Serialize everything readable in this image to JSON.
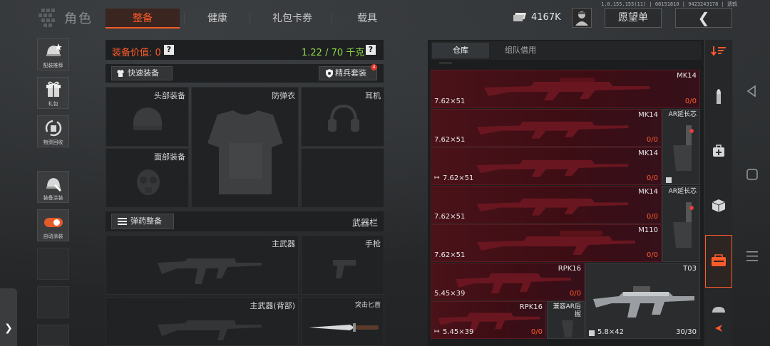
{
  "header": {
    "brand": "角色",
    "tabs": [
      {
        "label": "整备",
        "active": true
      },
      {
        "label": "健康",
        "active": false
      },
      {
        "label": "礼包卡券",
        "active": false
      },
      {
        "label": "载具",
        "active": false
      }
    ],
    "version": "1.0.155.155(11) | 08151810 | 9423243178 | 遗鹤",
    "currency": "4167K",
    "wishlist_label": "愿望单",
    "back_icon": "chevron-left-icon"
  },
  "sidebar": {
    "items": [
      {
        "label": "配装推荐",
        "icon": "helmet-star-icon"
      },
      {
        "label": "礼包",
        "icon": "gift-icon"
      },
      {
        "label": "物资回收",
        "icon": "recycle-icon"
      },
      {
        "label": "装备涂装",
        "icon": "paint-helmet-icon"
      },
      {
        "label": "自动涂装",
        "icon": "toggle-icon",
        "toggle_on": true
      }
    ]
  },
  "loadout": {
    "value_label": "装备价值: 0",
    "weight": "1.22 / 70 千克",
    "quick_equip": "快速装备",
    "elite_kit": "精兵套装",
    "elite_badge": "4",
    "slots": {
      "head": "头部装备",
      "armor": "防弹衣",
      "headset": "耳机",
      "face": "面部装备"
    },
    "ammo_equip": "弹药整备",
    "weapon_bar": "武器栏",
    "weapons": {
      "primary": "主武器",
      "pistol": "手枪",
      "primary_back": "主武器(背部)",
      "melee": "突击匕首"
    }
  },
  "warehouse": {
    "tabs": [
      {
        "label": "仓库",
        "active": true
      },
      {
        "label": "组队借用",
        "active": false
      }
    ],
    "items": [
      {
        "name": "MK14",
        "caliber": "7.62×51",
        "count": "0/0",
        "borrowed": false
      },
      {
        "name": "MK14",
        "caliber": "7.62×51",
        "count": "0/0",
        "borrowed": false
      },
      {
        "name": "MK14",
        "caliber": "7.62×51",
        "count": "0/0",
        "borrowed": true
      },
      {
        "name": "MK14",
        "caliber": "7.62×51",
        "count": "0/0",
        "borrowed": false
      },
      {
        "name": "M110",
        "caliber": "7.62×51",
        "count": "0/0",
        "borrowed": false
      },
      {
        "name": "RPK16",
        "caliber": "5.45×39",
        "count": "0/0",
        "borrowed": false
      },
      {
        "name": "RPK16",
        "caliber": "5.45×39",
        "count": "0/0",
        "borrowed": true
      }
    ],
    "attachments": [
      {
        "name": "AR延长芯"
      },
      {
        "name": "AR延长芯"
      },
      {
        "name": "兼容AR后握"
      }
    ],
    "t03": {
      "name": "T03",
      "caliber": "5.8×42",
      "count": "30/30"
    }
  },
  "right_nav": {
    "icons": [
      "filter-sort-icon",
      "ammo-icon",
      "medkit-icon",
      "box-icon",
      "backpack-icon",
      "helmet-icon",
      "collapse-arrow-icon"
    ]
  },
  "colors": {
    "accent": "#ff5a2a",
    "weight": "#8ed64a",
    "item_bg": "#4a1219"
  }
}
